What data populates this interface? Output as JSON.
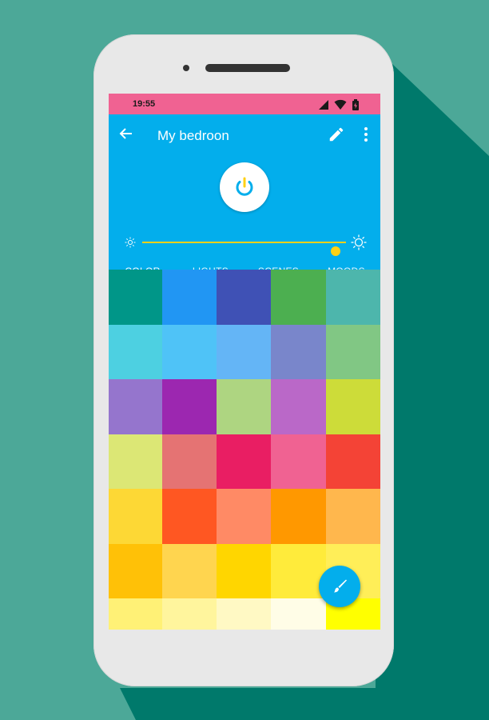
{
  "status_bar": {
    "time": "19:55",
    "icons": [
      "signal-icon",
      "wifi-icon",
      "battery-icon"
    ]
  },
  "app_bar": {
    "title": "My bedroon",
    "back_icon": "arrow-back-icon",
    "edit_icon": "pencil-icon",
    "more_icon": "more-vert-icon"
  },
  "power": {
    "icon": "power-icon",
    "accent": "#fed116"
  },
  "brightness": {
    "level": 0.95,
    "min_icon": "sun-small-icon",
    "max_icon": "sun-large-icon"
  },
  "tabs": [
    {
      "label": "COLOR",
      "active": true
    },
    {
      "label": "LIGHTS",
      "active": false
    },
    {
      "label": "SCENES",
      "active": false
    },
    {
      "label": "MOODS",
      "active": false
    }
  ],
  "colors": {
    "status_bar": "#f06292",
    "app_bar": "#03aeec",
    "accent": "#fed116"
  },
  "swatches": [
    "#009688",
    "#2196f3",
    "#3f51b5",
    "#4caf50",
    "#4db6ac",
    "#4dd0e1",
    "#4fc3f7",
    "#64b5f6",
    "#7986cb",
    "#81c784",
    "#9575cd",
    "#9c27b0",
    "#aed581",
    "#ba68c8",
    "#cddc39",
    "#dce775",
    "#e57373",
    "#e91e63",
    "#f06292",
    "#f44336",
    "#fdd835",
    "#ff5722",
    "#ff8a65",
    "#ff9800",
    "#ffb74d",
    "#ffc107",
    "#ffd54f",
    "#ffd600",
    "#ffeb3b",
    "#ffee58",
    "#fff176",
    "#fff59d",
    "#fff9c4",
    "#fffde7",
    "#ffff00"
  ],
  "fab": {
    "icon": "brush-icon"
  }
}
